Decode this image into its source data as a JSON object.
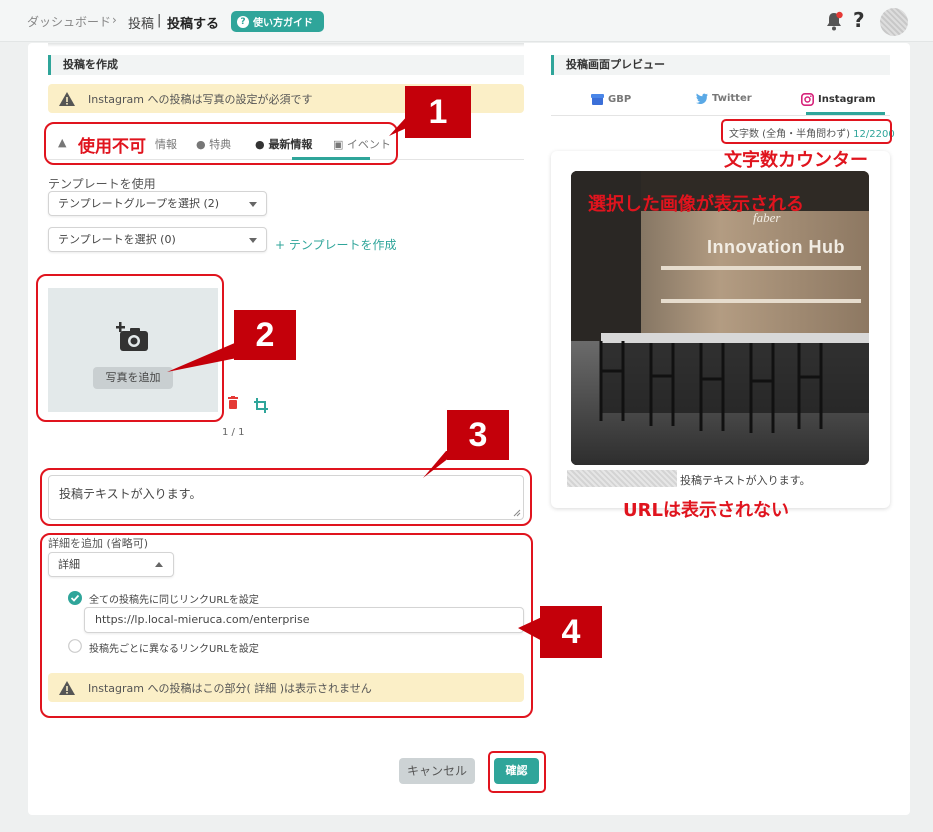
{
  "breadcrumb": {
    "dashboard": "ダッシュボード",
    "sep": "›",
    "post": "投稿",
    "bar": "|",
    "current": "投稿する"
  },
  "guide_button": {
    "label": "使い方ガイド",
    "icon": "question-icon"
  },
  "header_icons": {
    "bell": "bell-icon",
    "help": "?",
    "avatar": "avatar"
  },
  "create_section": {
    "title": "投稿を作成",
    "instagram_warning": "Instagram への投稿は写真の設定が必須です",
    "tabs": [
      {
        "label": "使用不可",
        "icon": "warning-icon"
      },
      {
        "label": "情報",
        "icon": "info-icon"
      },
      {
        "label": "特典",
        "icon": "tag-icon"
      },
      {
        "label": "最新情報",
        "icon": "info-icon"
      },
      {
        "label": "イベント",
        "icon": "calendar-icon"
      }
    ],
    "template_label": "テンプレートを使用",
    "template_group_select": "テンプレートグループを選択 (2)",
    "template_select": "テンプレートを選択 (0)",
    "create_template_link": "+ テンプレートを作成",
    "add_photo_label": "写真を追加",
    "photo_counter": "1 / 1",
    "post_text": "投稿テキストが入ります。",
    "details_label": "詳細を追加 (省略可)",
    "details_toggle": "詳細",
    "radio_same_url": "全ての投稿先に同じリンクURLを設定",
    "url_value": "https://lp.local-mieruca.com/enterprise",
    "radio_diff_url": "投稿先ごとに異なるリンクURLを設定",
    "details_warning": "Instagram への投稿はこの部分( 詳細 )は表示されません",
    "cancel_label": "キャンセル",
    "confirm_label": "確認"
  },
  "preview_section": {
    "title": "投稿画面プレビュー",
    "tabs": [
      {
        "label": "GBP",
        "icon": "gbp-icon"
      },
      {
        "label": "Twitter",
        "icon": "twitter-icon"
      },
      {
        "label": "Instagram",
        "icon": "instagram-icon"
      }
    ],
    "char_count_label": "文字数 (全角・半角問わず)",
    "char_count_value": "12/2200",
    "photo_sign_small": "faber",
    "photo_sign_main": "Innovation Hub",
    "preview_text": "投稿テキストが入ります。"
  },
  "annotations": {
    "n1": "1",
    "n2": "2",
    "n3": "3",
    "n4": "4",
    "unavailable": "使用不可",
    "char_counter": "文字数カウンター",
    "selected_image": "選択した画像が表示される",
    "url_not_shown": "URLは表示されない"
  },
  "colors": {
    "accent": "#2fa59a",
    "annotation_red": "#e0141e",
    "badge_red": "#c4000a",
    "warning_bg": "#fbefc7"
  }
}
